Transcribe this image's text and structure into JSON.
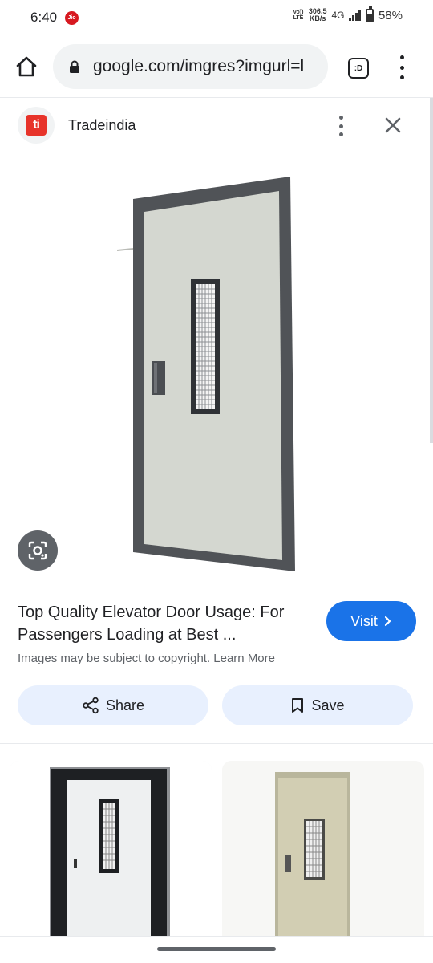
{
  "status": {
    "time": "6:40",
    "carrier_badge": "Jio",
    "volte": "Vo)) LTE",
    "net_speed_value": "306.5",
    "net_speed_unit": "KB/s",
    "network": "4G",
    "battery": "58%"
  },
  "browser": {
    "url": "google.com/imgres?imgurl=l",
    "tab_label": ":D"
  },
  "source": {
    "name": "Tradeindia",
    "logo_text": "ti"
  },
  "result": {
    "title": "Top Quality Elevator Door Usage: For Passengers Loading at Best ...",
    "visit_label": "Visit",
    "copyright_note": "Images may be subject to copyright. Learn More"
  },
  "actions": {
    "share_label": "Share",
    "save_label": "Save"
  },
  "colors": {
    "accent": "#1a73e8",
    "chip_bg": "#e8f0fe",
    "source_brand": "#e7332a"
  }
}
